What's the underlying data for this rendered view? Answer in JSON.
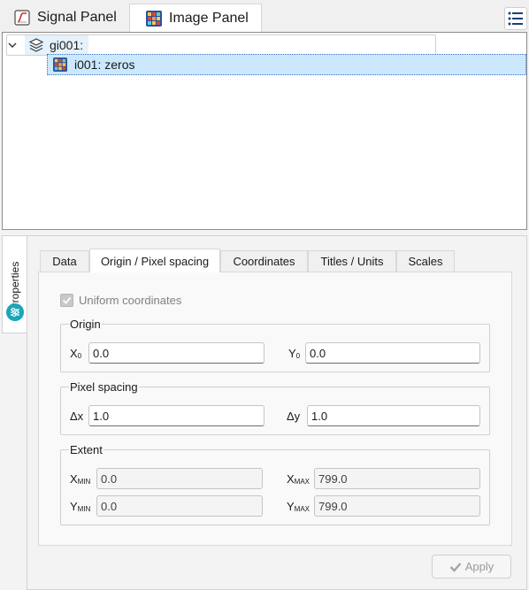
{
  "tabs": {
    "signal_panel": "Signal Panel",
    "image_panel": "Image Panel"
  },
  "tree": {
    "group_label": "gi001:",
    "item_label": "i001: zeros"
  },
  "side_tab": {
    "label": "Properties"
  },
  "property_tabs": [
    "Data",
    "Origin / Pixel spacing",
    "Coordinates",
    "Titles / Units",
    "Scales"
  ],
  "origin_pane": {
    "uniform_coordinates_label": "Uniform coordinates",
    "uniform_coordinates_checked": true,
    "origin_title": "Origin",
    "x0_label": "X",
    "x0_sub": "0",
    "x0_value": "0.0",
    "y0_label": "Y",
    "y0_sub": "0",
    "y0_value": "0.0",
    "pixel_spacing_title": "Pixel spacing",
    "dx_label": "Δx",
    "dx_value": "1.0",
    "dy_label": "Δy",
    "dy_value": "1.0",
    "extent_title": "Extent",
    "xmin_label": "X",
    "xmin_sub": "MIN",
    "xmin_value": "0.0",
    "xmax_label": "X",
    "xmax_sub": "MAX",
    "xmax_value": "799.0",
    "ymin_label": "Y",
    "ymin_sub": "MIN",
    "ymin_value": "0.0",
    "ymax_label": "Y",
    "ymax_sub": "MAX",
    "ymax_value": "799.0"
  },
  "apply_label": "Apply",
  "colors": {
    "selection": "#cce8ff",
    "accent": "#1aa6b8"
  }
}
